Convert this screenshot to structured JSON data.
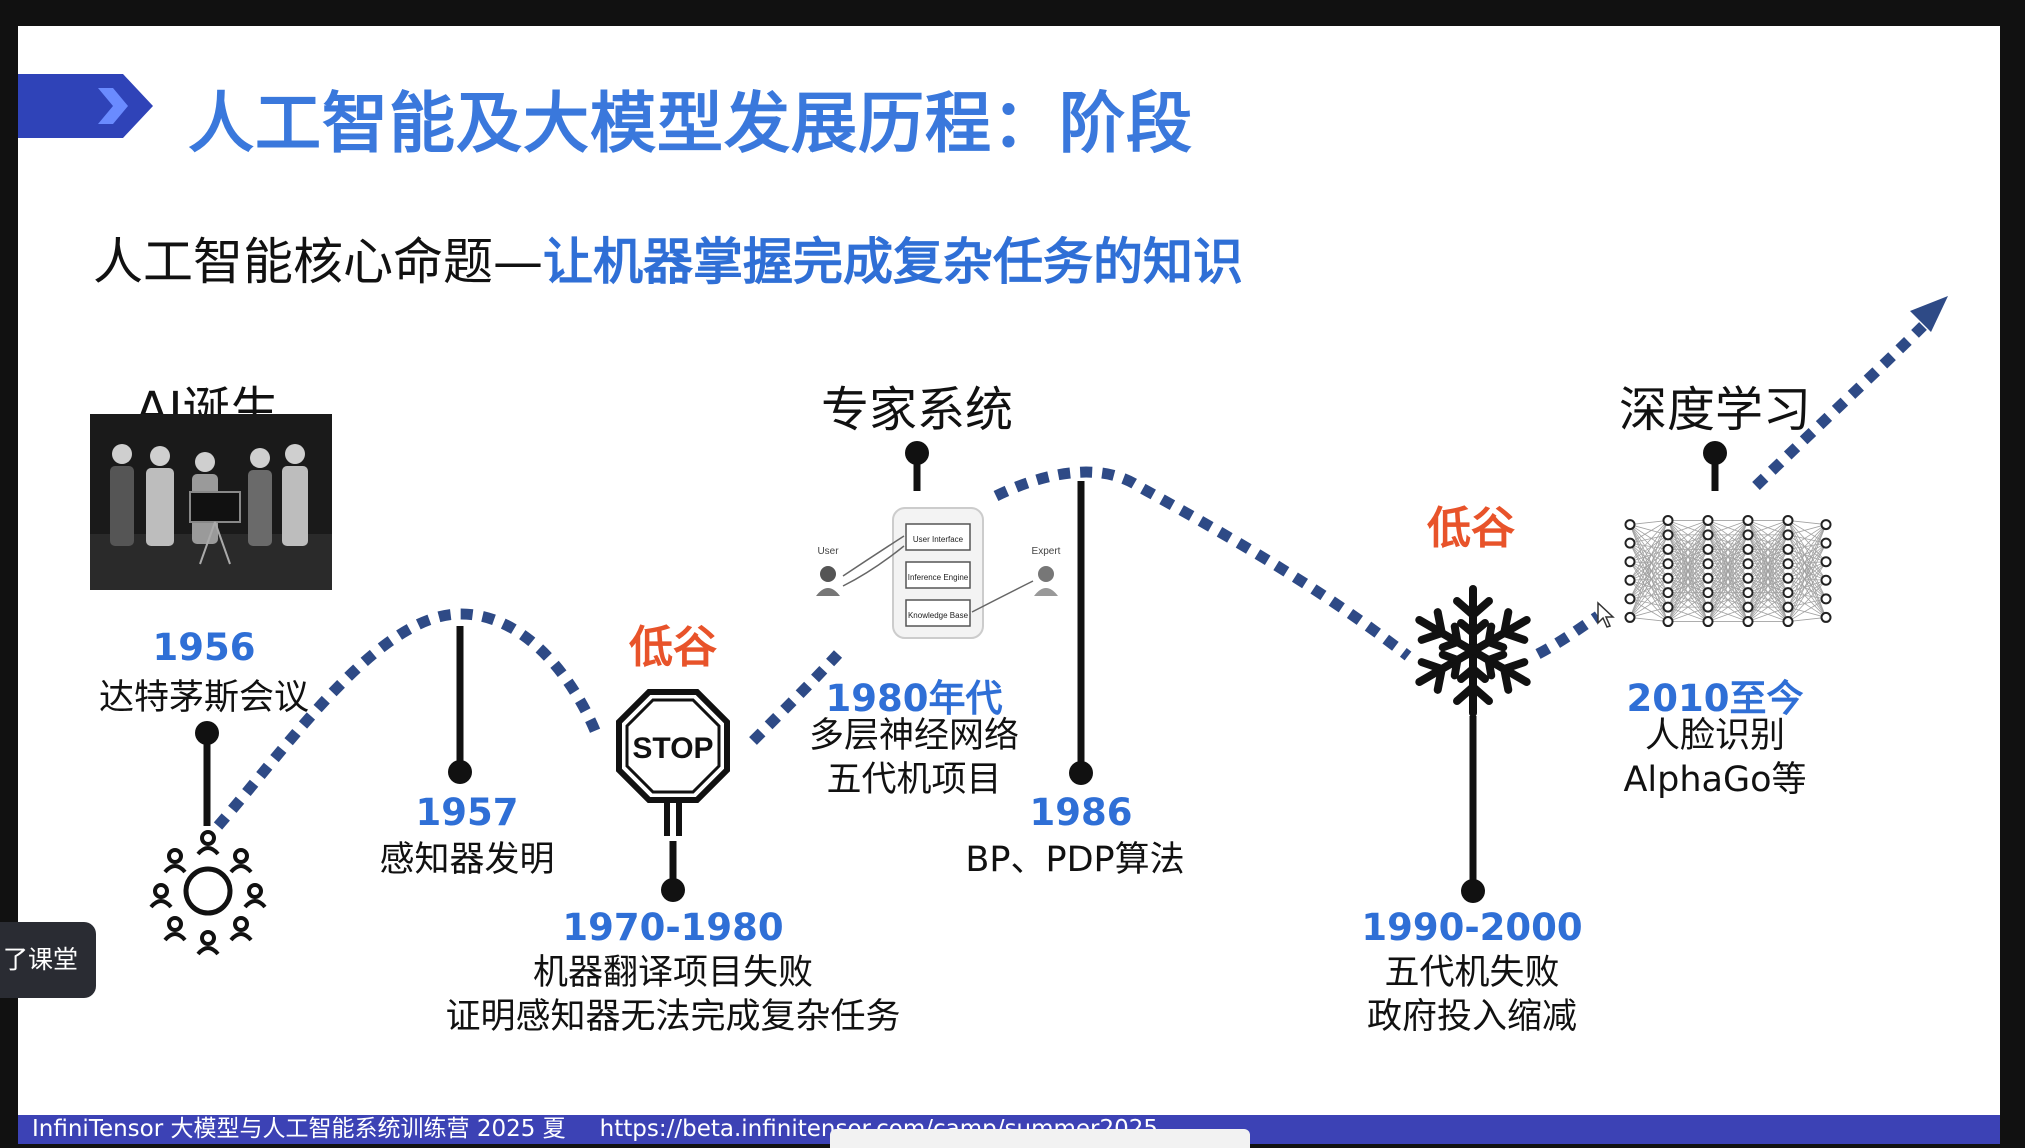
{
  "slide": {
    "title": "人工智能及大模型发展历程：阶段",
    "subtitle_prefix": "人工智能核心命题—",
    "subtitle_highlight": "让机器掌握完成复杂任务的知识"
  },
  "headings": {
    "ai_birth": "AI诞生",
    "expert_system": "专家系统",
    "deep_learning": "深度学习"
  },
  "low_labels": {
    "first": "低谷",
    "second": "低谷"
  },
  "milestones": {
    "m1956": {
      "year": "1956",
      "desc": "达特茅斯会议"
    },
    "m1957": {
      "year": "1957",
      "desc": "感知器发明"
    },
    "m1970": {
      "year": "1970-1980",
      "line1": "机器翻译项目失败",
      "line2": "证明感知器无法完成复杂任务"
    },
    "m1980s": {
      "year": "1980年代",
      "line1": "多层神经网络",
      "line2": "五代机项目"
    },
    "m1986": {
      "year": "1986",
      "desc": "BP、PDP算法"
    },
    "m1990": {
      "year": "1990-2000",
      "line1": "五代机失败",
      "line2": "政府投入缩减"
    },
    "m2010": {
      "year": "2010至今",
      "line1": "人脸识别",
      "line2": "AlphaGo等"
    }
  },
  "expert_diagram": {
    "user": "User",
    "expert": "Expert",
    "ui": "User Interface",
    "engine": "Inference Engine",
    "kb": "Knowledge Base"
  },
  "stop_sign": "STOP",
  "footer": {
    "brand": "InfiniTensor 大模型与人工智能系统训练营 2025 夏",
    "url": "https://beta.infinitensor.com/camp/summer2025"
  },
  "toast": "了课堂",
  "colors": {
    "title_blue": "#3a78dc",
    "year_blue": "#2f6fd6",
    "low_orange": "#e8532a",
    "dash_navy": "#2e4a86",
    "footer_bar": "#3c42b5"
  }
}
